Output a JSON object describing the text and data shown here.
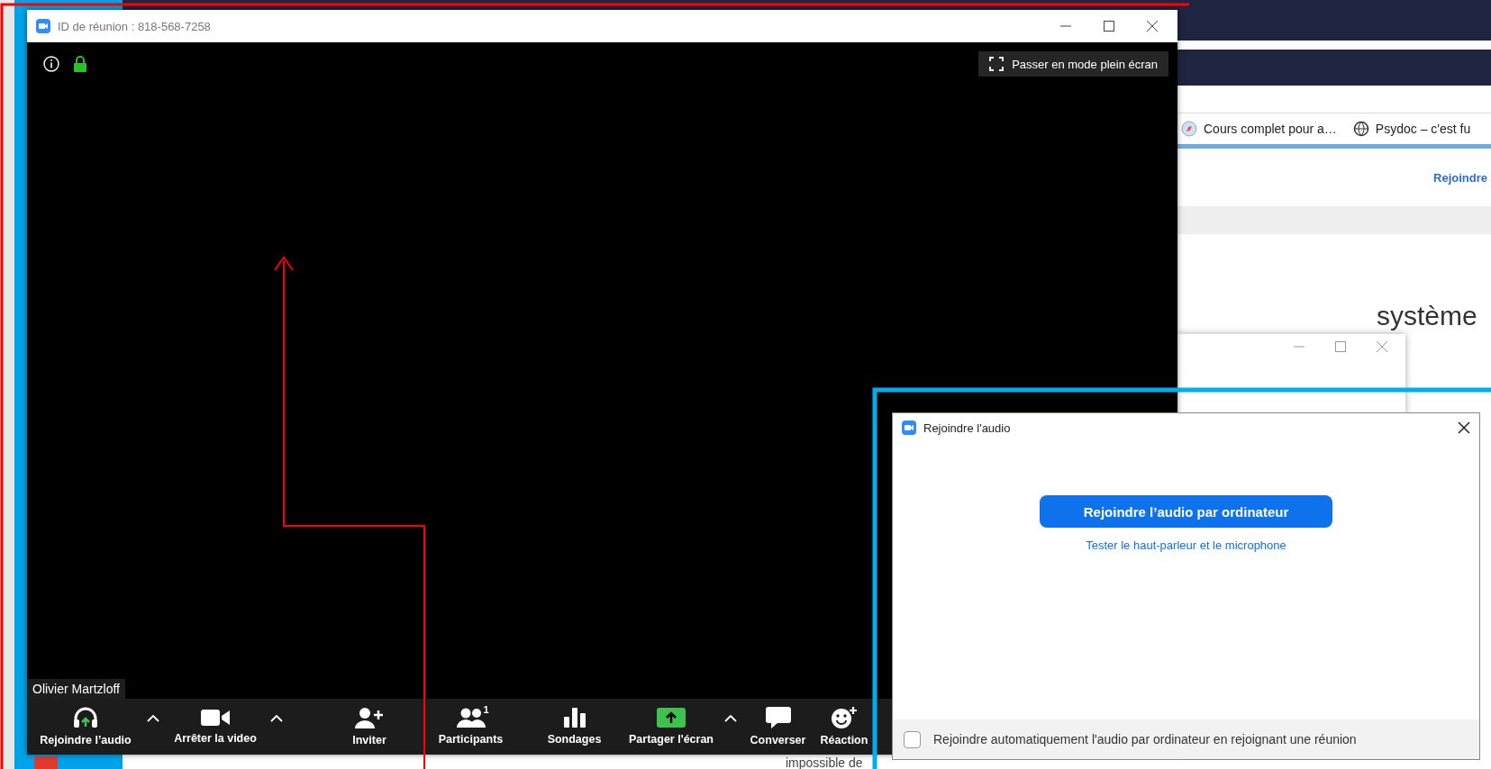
{
  "browser": {
    "bookmarks": [
      {
        "label": "Cours complet pour a…"
      },
      {
        "label": "Psydoc – c'est fu"
      }
    ],
    "join_link": "Rejoindre",
    "heading": "système",
    "footer_text": "impossible de"
  },
  "meeting_window": {
    "title": "ID de réunion : 818-568-7258",
    "fullscreen_button": "Passer en mode plein écran",
    "participant_name": "Olivier Martzloff",
    "toolbar": [
      {
        "kind": "button",
        "label": "Rejoindre l’audio"
      },
      {
        "kind": "caret"
      },
      {
        "kind": "button",
        "label": "Arrêter la video"
      },
      {
        "kind": "caret"
      },
      {
        "kind": "button",
        "label": "Inviter"
      },
      {
        "kind": "button",
        "label": "Participants",
        "badge": "1"
      },
      {
        "kind": "button",
        "label": "Sondages"
      },
      {
        "kind": "button",
        "label": "Partager l'écran"
      },
      {
        "kind": "caret"
      },
      {
        "kind": "button",
        "label": "Converser"
      },
      {
        "kind": "button",
        "label": "Réaction"
      }
    ]
  },
  "audio_dialog": {
    "title": "Rejoindre l'audio",
    "primary_button": "Rejoindre l’audio par ordinateur",
    "test_link": "Tester le haut-parleur et le microphone",
    "auto_join": {
      "label": "Rejoindre automatiquement l'audio par ordinateur en rejoignant une réunion",
      "checked": false
    }
  }
}
